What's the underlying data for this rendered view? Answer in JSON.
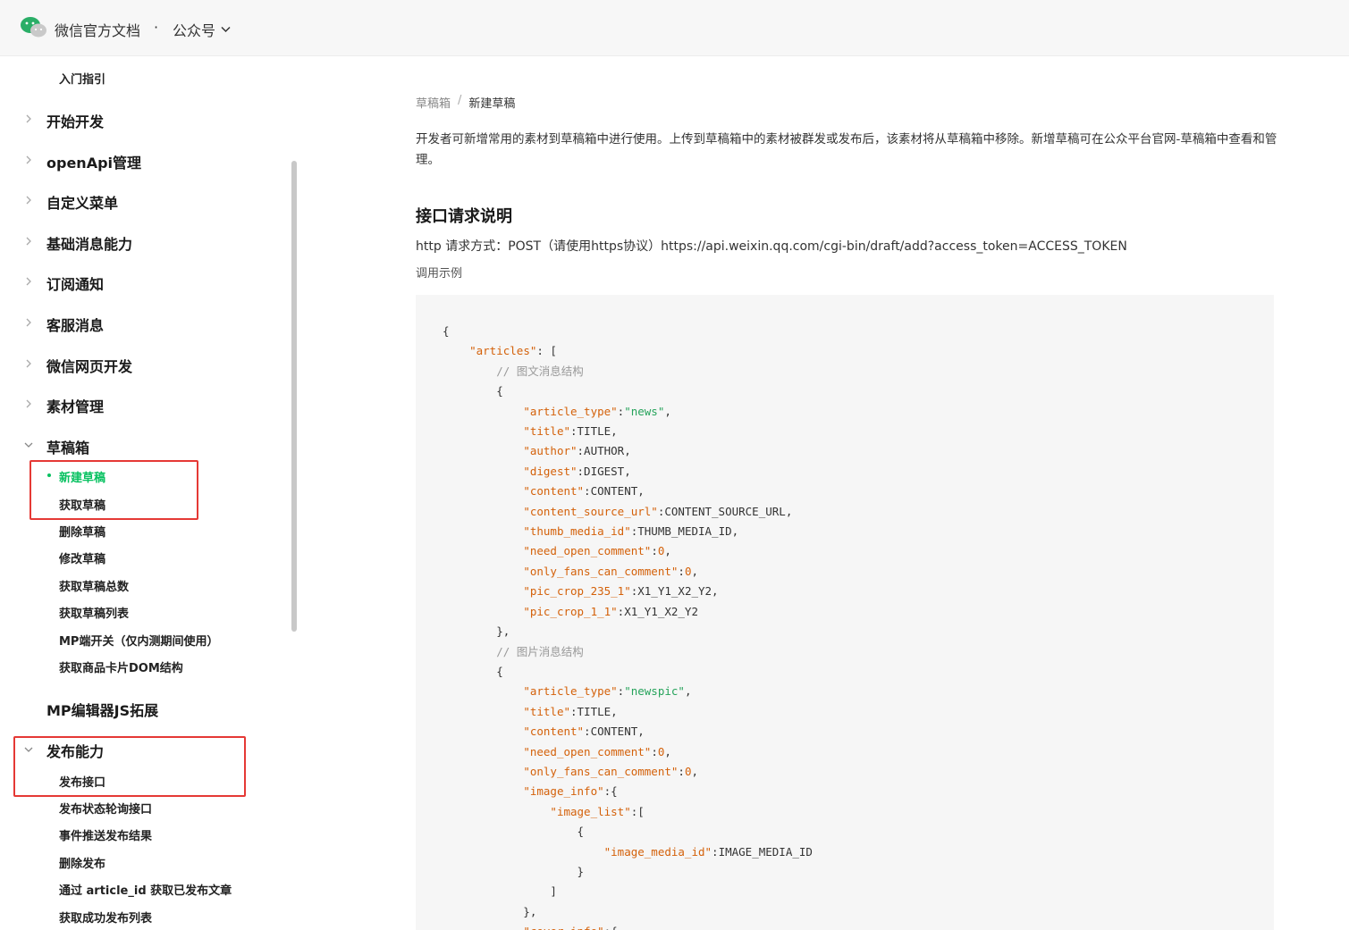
{
  "header": {
    "brand": "微信官方文档",
    "separator": "·",
    "section": "公众号"
  },
  "sidebar": {
    "intro": "入门指引",
    "groups": [
      {
        "label": "开始开发"
      },
      {
        "label": "openApi管理"
      },
      {
        "label": "自定义菜单"
      },
      {
        "label": "基础消息能力"
      },
      {
        "label": "订阅通知"
      },
      {
        "label": "客服消息"
      },
      {
        "label": "微信网页开发"
      },
      {
        "label": "素材管理"
      },
      {
        "label": "草稿箱"
      }
    ],
    "draft_items": [
      "新建草稿",
      "获取草稿",
      "删除草稿",
      "修改草稿",
      "获取草稿总数",
      "获取草稿列表",
      "MP端开关（仅内测期间使用）",
      "获取商品卡片DOM结构"
    ],
    "mp_editor": "MP编辑器JS拓展",
    "publish_group": "发布能力",
    "publish_items": [
      "发布接口",
      "发布状态轮询接口",
      "事件推送发布结果",
      "删除发布",
      "通过 article_id 获取已发布文章",
      "获取成功发布列表"
    ]
  },
  "main": {
    "breadcrumb": {
      "parent": "草稿箱",
      "separator": "/",
      "current": "新建草稿"
    },
    "intro": "开发者可新增常用的素材到草稿箱中进行使用。上传到草稿箱中的素材被群发或发布后，该素材将从草稿箱中移除。新增草稿可在公众平台官网-草稿箱中查看和管理。",
    "section_title": "接口请求说明",
    "request_line": "http 请求方式：POST（请使用https协议）https://api.weixin.qq.com/cgi-bin/draft/add?access_token=ACCESS_TOKEN",
    "call_example_label": "调用示例"
  },
  "code": {
    "comment1": "// 图文消息结构",
    "comment2": "// 图片消息结构"
  },
  "colors": {
    "accent": "#07c160",
    "highlight": "#e53935"
  }
}
